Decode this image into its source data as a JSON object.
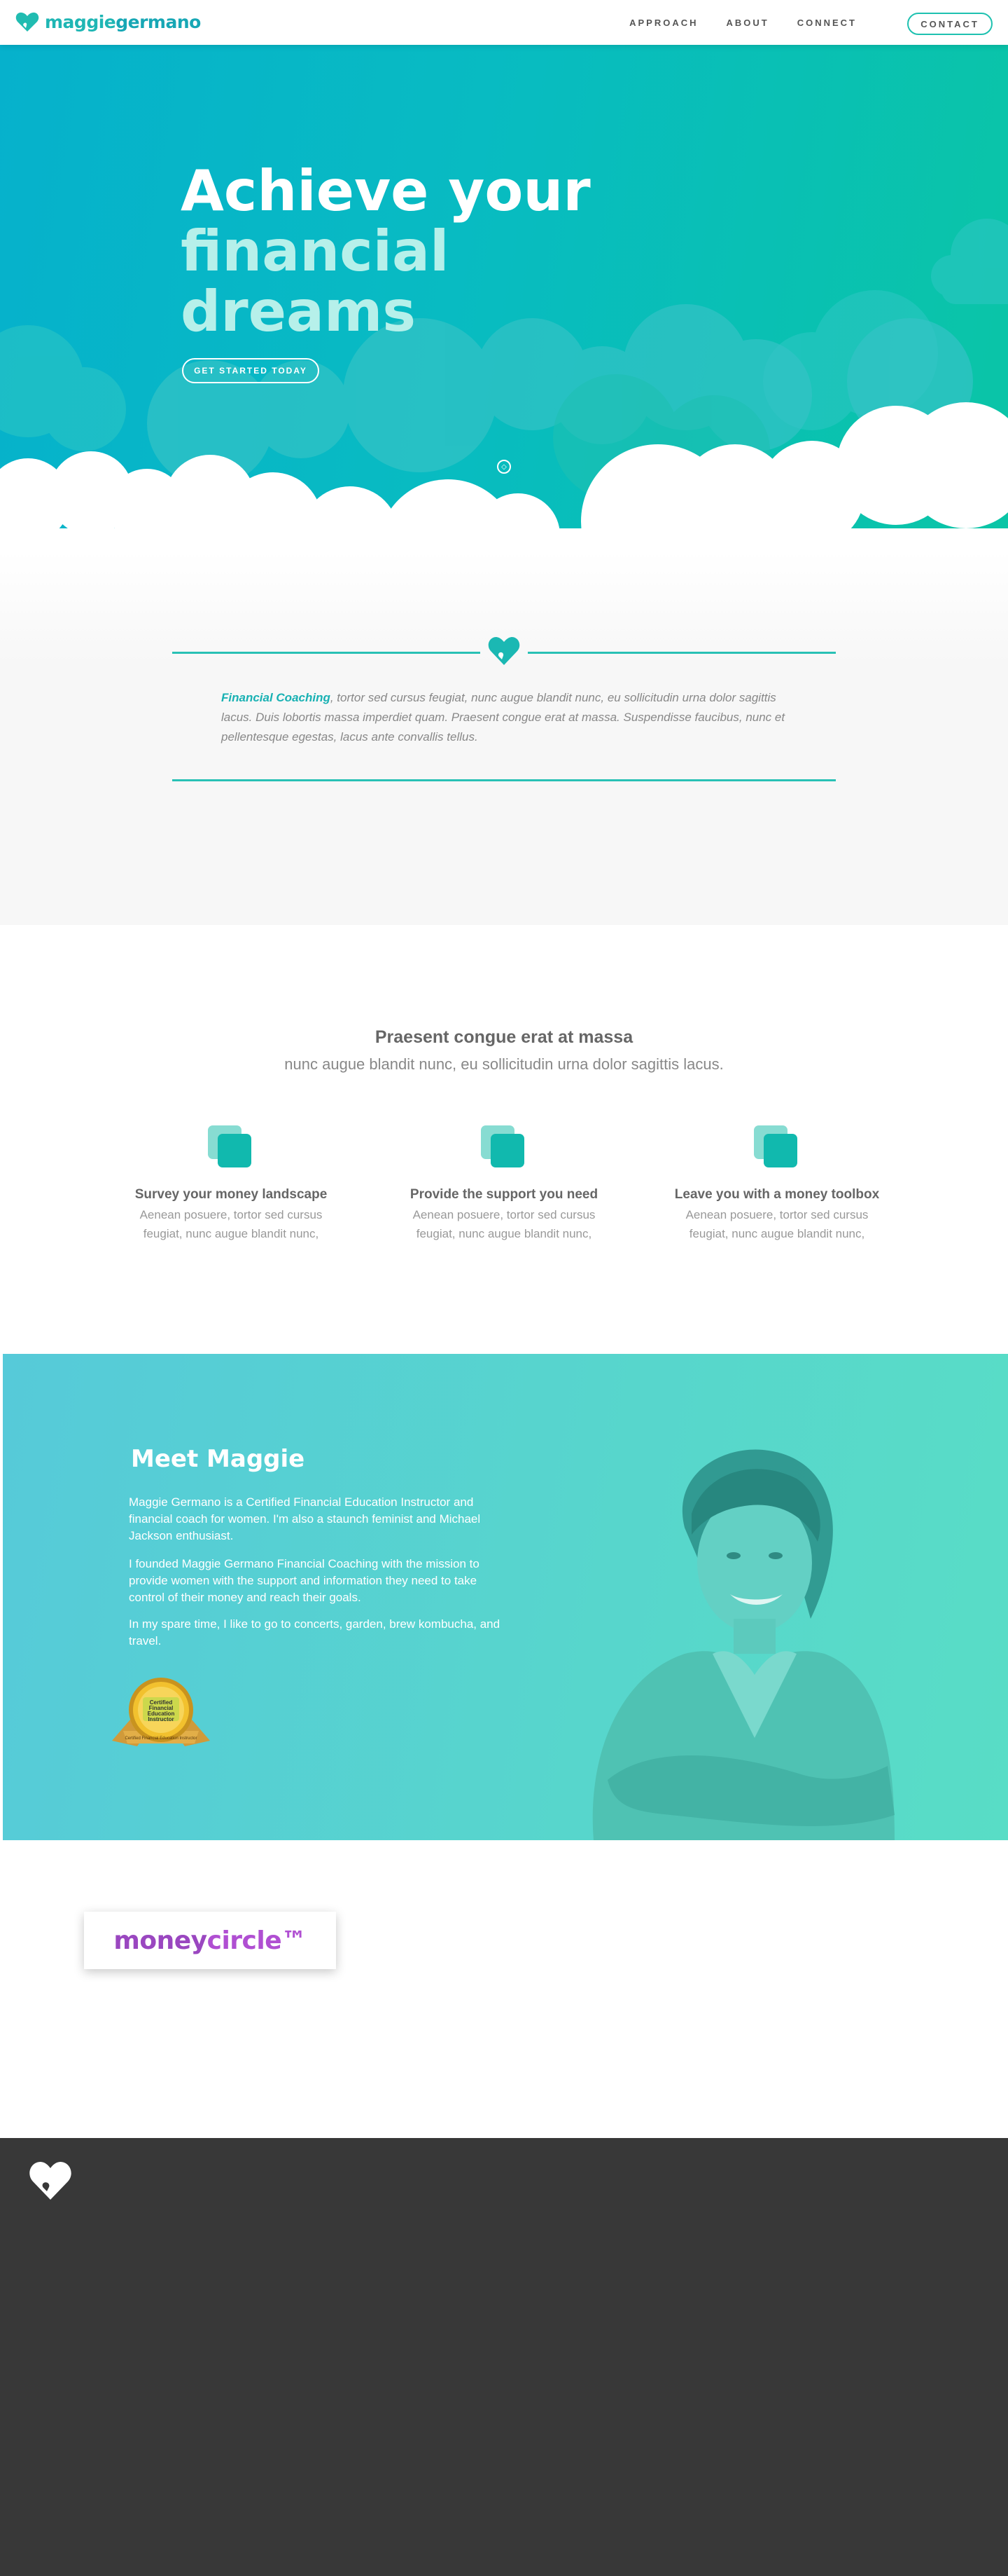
{
  "nav": {
    "brand_part1": "maggie",
    "brand_part2": "germano",
    "links": [
      "APPROACH",
      "ABOUT",
      "CONNECT"
    ],
    "contact": "CONTACT"
  },
  "hero": {
    "title_line1": "Achieve your",
    "title_line2": "financial",
    "title_line3": "dreams",
    "cta": "GET STARTED TODAY"
  },
  "intro": {
    "highlight": "Financial Coaching",
    "text": ", tortor sed cursus feugiat, nunc augue blandit nunc, eu sollicitudin urna dolor sagittis lacus. Duis lobortis massa imperdiet quam. Praesent congue erat at massa. Suspendisse faucibus, nunc et pellentesque egestas, lacus ante convallis tellus."
  },
  "services": {
    "title": "Praesent congue erat at massa",
    "subtitle": "nunc augue blandit nunc, eu sollicitudin urna dolor sagittis lacus.",
    "features": [
      {
        "title": "Survey your money landscape",
        "text": "Aenean posuere, tortor sed cursus feugiat, nunc augue blandit nunc,"
      },
      {
        "title": "Provide the support you need",
        "text": "Aenean posuere, tortor sed cursus feugiat, nunc augue blandit nunc,"
      },
      {
        "title": "Leave you with a money toolbox",
        "text": "Aenean posuere, tortor sed cursus feugiat, nunc augue blandit nunc,"
      }
    ]
  },
  "meet": {
    "title": "Meet Maggie",
    "paragraphs": [
      "Maggie Germano is a Certified Financial Education Instructor and financial coach for women. I'm also a staunch feminist and Michael Jackson enthusiast.",
      "I founded Maggie Germano Financial Coaching with the mission to provide women with the support and information they need to take control of their money and reach their goals.",
      "In my spare time, I like to go to concerts, garden, brew kombucha, and travel."
    ],
    "badge_lines": [
      "Certified",
      "Financial",
      "Education",
      "Instructor"
    ],
    "badge_ribbon": "Certified Financial Education Instructor"
  },
  "moneycircle": {
    "part1": "money",
    "part2": "circle™"
  },
  "colors": {
    "teal": "#1fb6b4",
    "hero_start": "#06b1cc",
    "hero_end": "#0ac5a6",
    "footer": "#383838",
    "purple": "#9a47c0"
  }
}
